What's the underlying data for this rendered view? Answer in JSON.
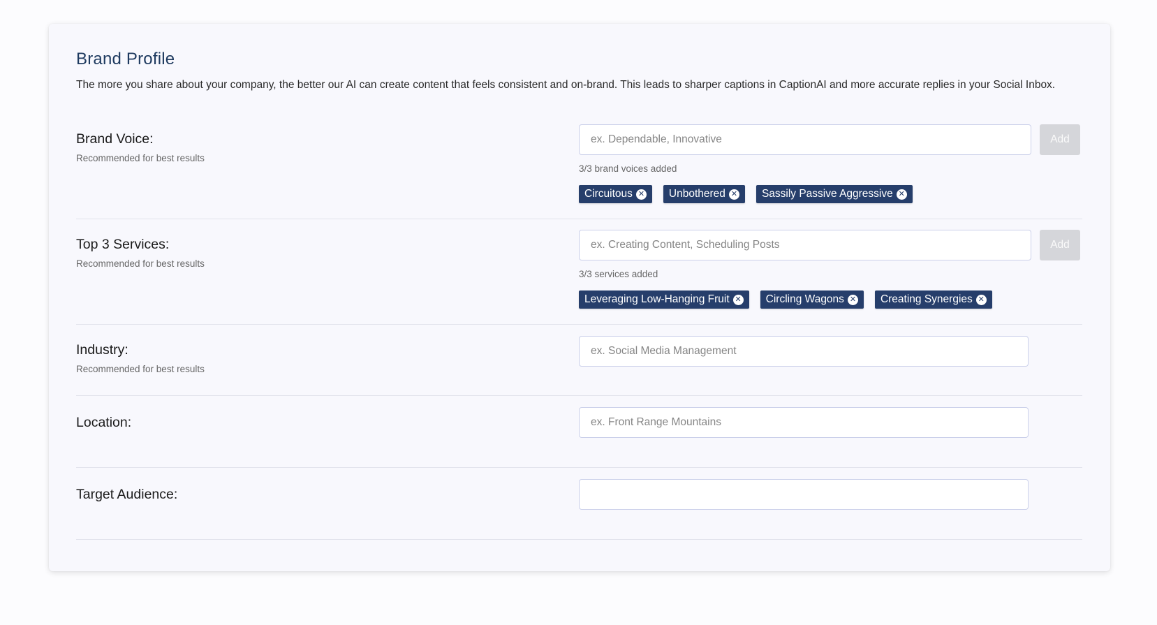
{
  "profile": {
    "title": "Brand Profile",
    "description": "The more you share about your company, the better our AI can create content that feels consistent and on-brand. This leads to sharper captions in CaptionAI and more accurate replies in your Social Inbox."
  },
  "brand_voice": {
    "label": "Brand Voice:",
    "hint": "Recommended for best results",
    "placeholder": "ex. Dependable, Innovative",
    "add_label": "Add",
    "count_text": "3/3 brand voices added",
    "chips": [
      "Circuitous",
      "Unbothered",
      "Sassily Passive Aggressive"
    ]
  },
  "services": {
    "label": "Top 3 Services:",
    "hint": "Recommended for best results",
    "placeholder": "ex. Creating Content, Scheduling Posts",
    "add_label": "Add",
    "count_text": "3/3 services added",
    "chips": [
      "Leveraging Low-Hanging Fruit",
      "Circling Wagons",
      "Creating Synergies"
    ]
  },
  "industry": {
    "label": "Industry:",
    "hint": "Recommended for best results",
    "placeholder": "ex. Social Media Management"
  },
  "location": {
    "label": "Location:",
    "placeholder": "ex. Front Range Mountains"
  },
  "target_audience": {
    "label": "Target Audience:",
    "placeholder": ""
  },
  "icons": {
    "chip_remove": "close-circle-icon"
  },
  "colors": {
    "title": "#1e3a5f",
    "chip_bg": "#263e6b",
    "add_button_disabled": "#d5d6da"
  }
}
